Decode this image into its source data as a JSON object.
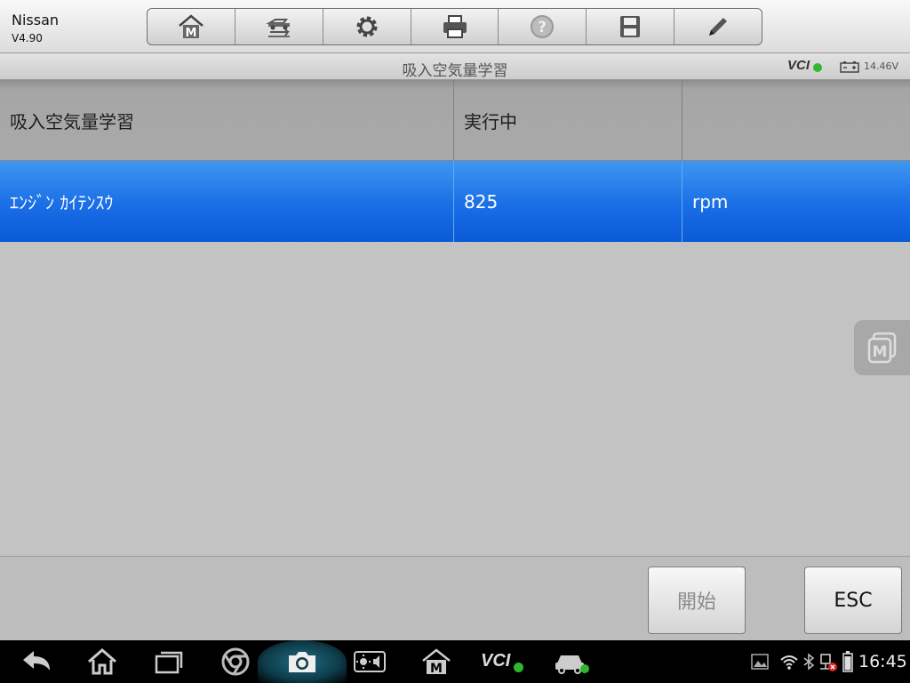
{
  "header": {
    "app_name": "Nissan",
    "version": "V4.90",
    "toolbar": [
      {
        "name": "home-m-icon"
      },
      {
        "name": "vehicle-swap-icon"
      },
      {
        "name": "gear-icon"
      },
      {
        "name": "printer-icon"
      },
      {
        "name": "help-icon"
      },
      {
        "name": "save-icon"
      },
      {
        "name": "pencil-icon"
      }
    ]
  },
  "titlebar": {
    "title": "吸入空気量学習",
    "vci": "VCI",
    "voltage": "14.46V"
  },
  "table": {
    "header": [
      "吸入空気量学習",
      "実行中",
      ""
    ],
    "rows": [
      [
        "ｴﾝｼﾞﾝ ｶｲﾃﾝｽｳ",
        "825",
        "rpm"
      ]
    ]
  },
  "buttons": {
    "start": "開始",
    "esc": "ESC"
  },
  "statusbar": {
    "time": "16:45",
    "vci": "VCI"
  },
  "colors": {
    "selected_row": "#1a6ee6",
    "ok_green": "#2fb82f"
  }
}
